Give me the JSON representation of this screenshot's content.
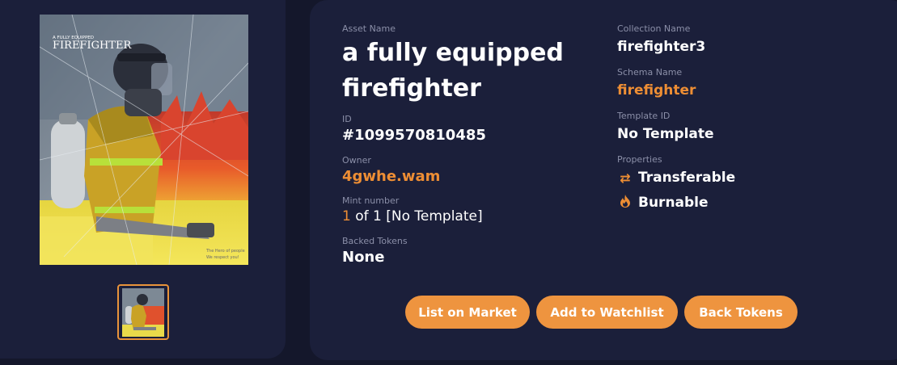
{
  "image_card": {
    "cover_small_text": "A FULLY EQUIPPED",
    "cover_title": "FIREFIGHTER",
    "cover_caption_line1": "The Hero of people",
    "cover_caption_line2": "We respect you!"
  },
  "details": {
    "asset_name_label": "Asset Name",
    "asset_name": "a fully equipped firefighter",
    "id_label": "ID",
    "id_value": "#1099570810485",
    "owner_label": "Owner",
    "owner_value": "4gwhe.wam",
    "mint_label": "Mint number",
    "mint_number": "1",
    "mint_rest": " of 1 [No Template]",
    "backed_label": "Backed Tokens",
    "backed_value": "None",
    "collection_label": "Collection Name",
    "collection_value": "firefighter3",
    "schema_label": "Schema Name",
    "schema_value": "firefighter",
    "template_label": "Template ID",
    "template_value": "No Template",
    "properties_label": "Properties",
    "properties": [
      {
        "icon": "transfer-icon",
        "label": "Transferable"
      },
      {
        "icon": "fire-icon",
        "label": "Burnable"
      }
    ]
  },
  "actions": {
    "list_market": "List on Market",
    "add_watchlist": "Add to Watchlist",
    "back_tokens": "Back Tokens"
  },
  "colors": {
    "background": "#14172b",
    "card": "#1b1f3a",
    "accent": "#ee8e34",
    "button": "#ee943f"
  }
}
